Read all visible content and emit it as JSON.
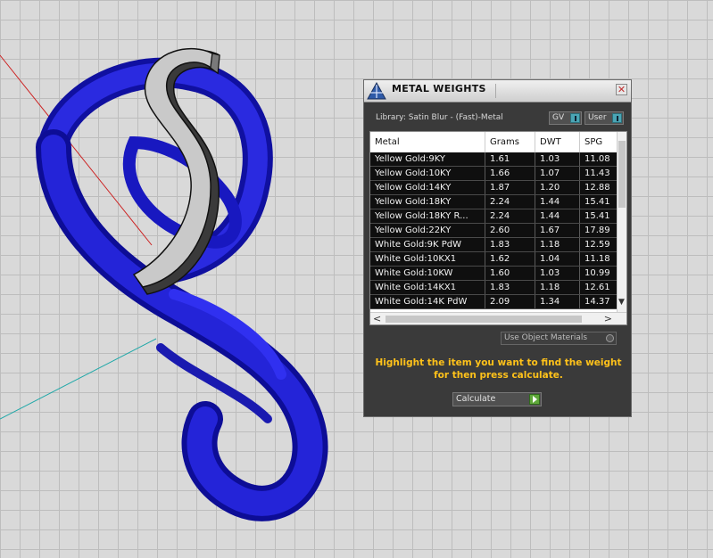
{
  "window": {
    "title": "METAL WEIGHTS",
    "close_glyph": "✕",
    "logo_icon": "metal-weights-logo-icon"
  },
  "library": {
    "label": "Library: Satin Blur - (Fast)-Metal",
    "gv_value": "GV",
    "user_value": "User"
  },
  "table": {
    "columns": [
      "Metal",
      "Grams",
      "DWT",
      "SPG"
    ],
    "rows": [
      [
        "Yellow Gold:9KY",
        "1.61",
        "1.03",
        "11.08"
      ],
      [
        "Yellow Gold:10KY",
        "1.66",
        "1.07",
        "11.43"
      ],
      [
        "Yellow Gold:14KY",
        "1.87",
        "1.20",
        "12.88"
      ],
      [
        "Yellow Gold:18KY",
        "2.24",
        "1.44",
        "15.41"
      ],
      [
        "Yellow Gold:18KY R...",
        "2.24",
        "1.44",
        "15.41"
      ],
      [
        "Yellow Gold:22KY",
        "2.60",
        "1.67",
        "17.89"
      ],
      [
        "White Gold:9K PdW",
        "1.83",
        "1.18",
        "12.59"
      ],
      [
        "White Gold:10KX1",
        "1.62",
        "1.04",
        "11.18"
      ],
      [
        "White Gold:10KW",
        "1.60",
        "1.03",
        "10.99"
      ],
      [
        "White Gold:14KX1",
        "1.83",
        "1.18",
        "12.61"
      ],
      [
        "White Gold:14K PdW",
        "2.09",
        "1.34",
        "14.37"
      ]
    ],
    "scroll_up_glyph": "▲",
    "scroll_down_glyph": "▼",
    "scroll_left_glyph": "<",
    "scroll_right_glyph": ">"
  },
  "options": {
    "use_object_materials": "Use Object Materials"
  },
  "instruction": "Highlight the item you want to find the weight for then press calculate.",
  "calculate": {
    "label": "Calculate"
  },
  "colors": {
    "ring": "#1a1ad6",
    "panel_bg": "#3a3a3a",
    "instruction_text": "#ffc21a",
    "accent_teal": "#4aa5b4",
    "go_green": "#5fa83a"
  }
}
